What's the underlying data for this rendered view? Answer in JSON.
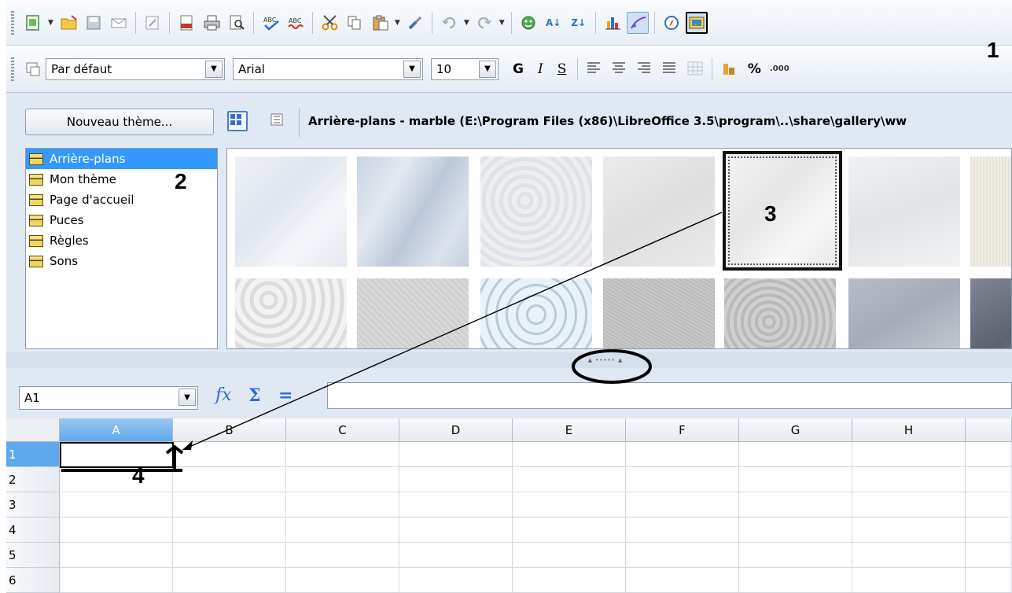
{
  "toolbar1": {
    "icons": [
      "new-document-icon",
      "open-folder-icon",
      "save-icon",
      "email-icon",
      "edit-file-icon",
      "export-pdf-icon",
      "print-icon",
      "print-preview-icon",
      "spellcheck-icon",
      "autospellcheck-icon",
      "cut-icon",
      "copy-icon",
      "paste-icon",
      "clone-format-icon",
      "undo-icon",
      "redo-icon",
      "navigator-icon",
      "sort-ascending-icon",
      "sort-descending-icon",
      "chart-icon",
      "draw-functions-icon",
      "navigator-compass-icon",
      "gallery-icon"
    ],
    "sort_asc_glyph": "A↓",
    "sort_desc_glyph": "Z↓"
  },
  "toolbar2": {
    "style_value": "Par défaut",
    "font_value": "Arial",
    "size_value": "10",
    "bold_label": "G",
    "italic_label": "I",
    "underline_label": "S",
    "percent_label": "%",
    "decimal_label": ".000"
  },
  "gallery": {
    "new_theme_label": "Nouveau thème...",
    "title": "Arrière-plans - marble (E:\\Program Files (x86)\\LibreOffice 3.5\\program\\..\\share\\gallery\\ww",
    "themes": [
      "Arrière-plans",
      "Mon thème",
      "Page d'accueil",
      "Puces",
      "Règles",
      "Sons"
    ],
    "selected_theme": "Arrière-plans"
  },
  "formula_bar": {
    "name_box_value": "A1",
    "fx_label": "fx",
    "sum_label": "Σ",
    "equals_label": "=",
    "formula_value": ""
  },
  "grid": {
    "columns": [
      "A",
      "B",
      "C",
      "D",
      "E",
      "F",
      "G",
      "H"
    ],
    "rows": [
      "1",
      "2",
      "3",
      "4",
      "5",
      "6"
    ],
    "active_cell": "A1"
  },
  "annotations": {
    "label_1": "1",
    "label_2": "2",
    "label_3": "3",
    "label_4": "4"
  },
  "colors": {
    "selection": "#3399ff",
    "column_header_selected": "#5ea8ec",
    "panel_background": "#dfe8f3"
  }
}
